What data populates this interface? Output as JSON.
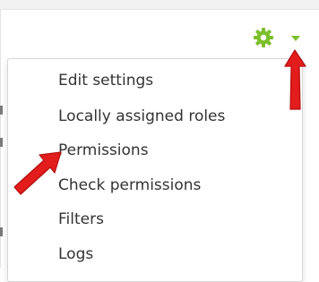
{
  "header": {
    "settings_icon": "gear-icon",
    "menu_toggle_icon": "caret-down-icon",
    "accent_color": "#7cbf2a"
  },
  "menu": {
    "items": [
      {
        "label": "Edit settings"
      },
      {
        "label": "Locally assigned roles"
      },
      {
        "label": "Permissions"
      },
      {
        "label": "Check permissions"
      },
      {
        "label": "Filters"
      },
      {
        "label": "Logs"
      }
    ]
  },
  "annotations": {
    "arrow_color": "#e31c1c"
  }
}
